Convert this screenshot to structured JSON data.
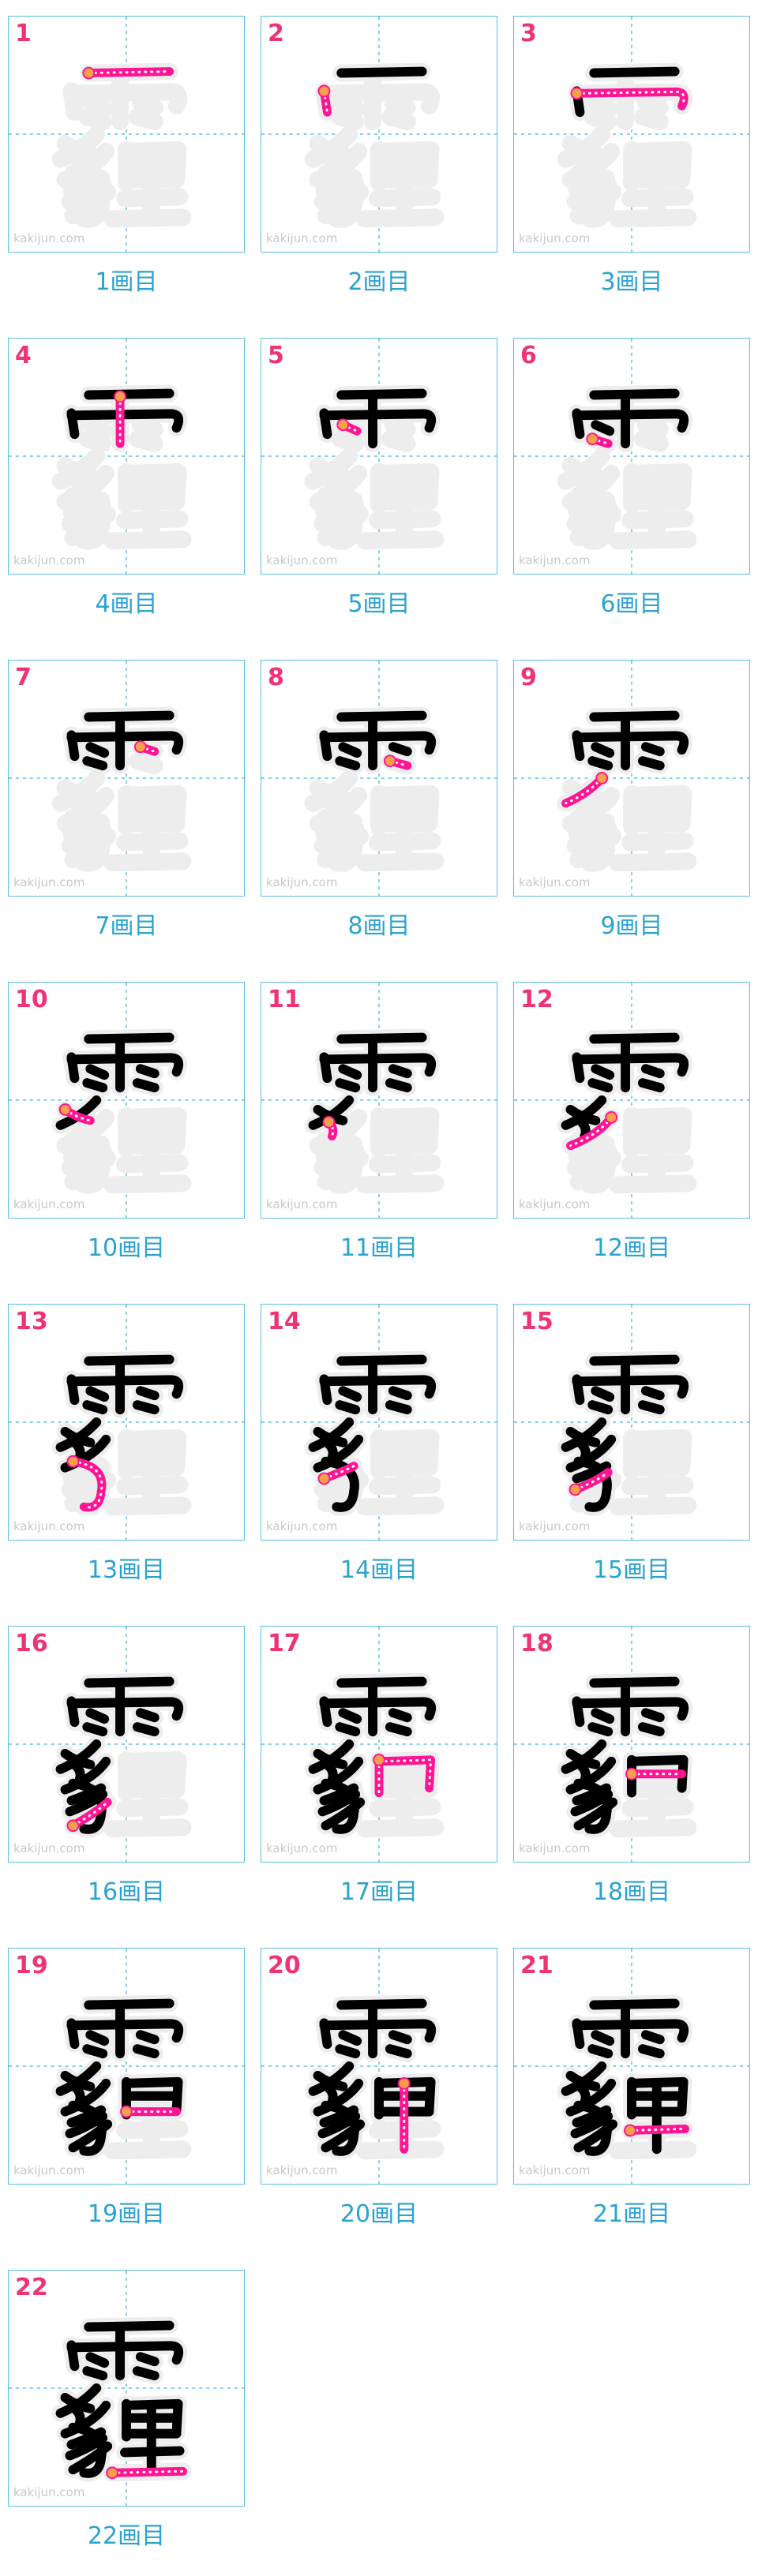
{
  "watermark": "kakijun.com",
  "colors": {
    "border": "#5bbfe0",
    "caption": "#2aa3d0",
    "number": "#ee3377",
    "current_stroke": "#ff1493",
    "done_stroke": "#000000",
    "ghost": "#ededed"
  },
  "cells": [
    {
      "number": "1",
      "caption": "1画目"
    },
    {
      "number": "2",
      "caption": "2画目"
    },
    {
      "number": "3",
      "caption": "3画目"
    },
    {
      "number": "4",
      "caption": "4画目"
    },
    {
      "number": "5",
      "caption": "5画目"
    },
    {
      "number": "6",
      "caption": "6画目"
    },
    {
      "number": "7",
      "caption": "7画目"
    },
    {
      "number": "8",
      "caption": "8画目"
    },
    {
      "number": "9",
      "caption": "9画目"
    },
    {
      "number": "10",
      "caption": "10画目"
    },
    {
      "number": "11",
      "caption": "11画目"
    },
    {
      "number": "12",
      "caption": "12画目"
    },
    {
      "number": "13",
      "caption": "13画目"
    },
    {
      "number": "14",
      "caption": "14画目"
    },
    {
      "number": "15",
      "caption": "15画目"
    },
    {
      "number": "16",
      "caption": "16画目"
    },
    {
      "number": "17",
      "caption": "17画目"
    },
    {
      "number": "18",
      "caption": "18画目"
    },
    {
      "number": "19",
      "caption": "19画目"
    },
    {
      "number": "20",
      "caption": "20画目"
    },
    {
      "number": "21",
      "caption": "21画目"
    },
    {
      "number": "22",
      "caption": "22画目"
    }
  ]
}
